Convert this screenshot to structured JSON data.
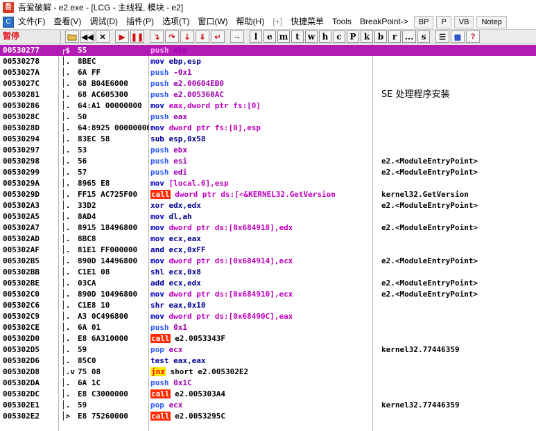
{
  "window": {
    "title": "吾爱破解 - e2.exe - [LCG - 主线程, 模块 - e2]"
  },
  "menu": {
    "items": [
      {
        "label": "文件(F)"
      },
      {
        "label": "查看(V)"
      },
      {
        "label": "调试(D)"
      },
      {
        "label": "插件(P)"
      },
      {
        "label": "选项(T)"
      },
      {
        "label": "窗口(W)"
      },
      {
        "label": "帮助(H)"
      },
      {
        "label": "[+]",
        "dim": true
      },
      {
        "label": "快捷菜单"
      },
      {
        "label": "Tools"
      },
      {
        "label": "BreakPoint->"
      }
    ],
    "tabs": [
      {
        "label": "BP"
      },
      {
        "label": "P"
      },
      {
        "label": "VB"
      },
      {
        "label": "Notep"
      }
    ]
  },
  "toolbar": {
    "status": "暂停",
    "letters": [
      "l",
      "e",
      "m",
      "t",
      "w",
      "h",
      "c",
      "P",
      "k",
      "b",
      "r",
      "...",
      "s"
    ]
  },
  "disasm": {
    "rows": [
      {
        "addr": "00530277",
        "mark": "┌$",
        "hex": "55",
        "mn": "push",
        "ops": "ebp",
        "cmt": "",
        "sel": true
      },
      {
        "addr": "00530278",
        "mark": "│.",
        "hex": "8BEC",
        "mn": "mov",
        "ops": "ebp,esp",
        "cmt": ""
      },
      {
        "addr": "0053027A",
        "mark": "│.",
        "hex": "6A FF",
        "mn": "push",
        "ops": "-0x1",
        "cmt": ""
      },
      {
        "addr": "0053027C",
        "mark": "│.",
        "hex": "68 B04E6000",
        "mn": "push",
        "ops": "e2.00604EB0",
        "cmt": ""
      },
      {
        "addr": "00530281",
        "mark": "│.",
        "hex": "68 AC605300",
        "mn": "push",
        "ops": "e2.005360AC",
        "cmt": "SE 处理程序安装",
        "cjk": true
      },
      {
        "addr": "00530286",
        "mark": "│.",
        "hex": "64:A1 00000000",
        "mn": "mov",
        "ops": "eax,dword ptr fs:[0]",
        "cmt": ""
      },
      {
        "addr": "0053028C",
        "mark": "│.",
        "hex": "50",
        "mn": "push",
        "ops": "eax",
        "cmt": ""
      },
      {
        "addr": "0053028D",
        "mark": "│.",
        "hex": "64:8925 00000000",
        "mn": "mov",
        "ops": "dword ptr fs:[0],esp",
        "cmt": ""
      },
      {
        "addr": "00530294",
        "mark": "│.",
        "hex": "83EC 58",
        "mn": "sub",
        "ops": "esp,0x58",
        "cmt": ""
      },
      {
        "addr": "00530297",
        "mark": "│.",
        "hex": "53",
        "mn": "push",
        "ops": "ebx",
        "cmt": ""
      },
      {
        "addr": "00530298",
        "mark": "│.",
        "hex": "56",
        "mn": "push",
        "ops": "esi",
        "cmt": "e2.<ModuleEntryPoint>"
      },
      {
        "addr": "00530299",
        "mark": "│.",
        "hex": "57",
        "mn": "push",
        "ops": "edi",
        "cmt": "e2.<ModuleEntryPoint>"
      },
      {
        "addr": "0053029A",
        "mark": "│.",
        "hex": "8965 E8",
        "mn": "mov",
        "ops": "[local.6],esp",
        "cmt": ""
      },
      {
        "addr": "0053029D",
        "mark": "│.",
        "hex": "FF15 AC725F00",
        "mn": "call",
        "ops": "dword ptr ds:[<&KERNEL32.GetVersion",
        "cmt": "kernel32.GetVersion"
      },
      {
        "addr": "005302A3",
        "mark": "│.",
        "hex": "33D2",
        "mn": "xor",
        "ops": "edx,edx",
        "cmt": "e2.<ModuleEntryPoint>"
      },
      {
        "addr": "005302A5",
        "mark": "│.",
        "hex": "8AD4",
        "mn": "mov",
        "ops": "dl,ah",
        "cmt": ""
      },
      {
        "addr": "005302A7",
        "mark": "│.",
        "hex": "8915 18496800",
        "mn": "mov",
        "ops": "dword ptr ds:[0x684918],edx",
        "cmt": "e2.<ModuleEntryPoint>"
      },
      {
        "addr": "005302AD",
        "mark": "│.",
        "hex": "8BC8",
        "mn": "mov",
        "ops": "ecx,eax",
        "cmt": ""
      },
      {
        "addr": "005302AF",
        "mark": "│.",
        "hex": "81E1 FF000000",
        "mn": "and",
        "ops": "ecx,0xFF",
        "cmt": ""
      },
      {
        "addr": "005302B5",
        "mark": "│.",
        "hex": "890D 14496800",
        "mn": "mov",
        "ops": "dword ptr ds:[0x684914],ecx",
        "cmt": "e2.<ModuleEntryPoint>"
      },
      {
        "addr": "005302BB",
        "mark": "│.",
        "hex": "C1E1 08",
        "mn": "shl",
        "ops": "ecx,0x8",
        "cmt": ""
      },
      {
        "addr": "005302BE",
        "mark": "│.",
        "hex": "03CA",
        "mn": "add",
        "ops": "ecx,edx",
        "cmt": "e2.<ModuleEntryPoint>"
      },
      {
        "addr": "005302C0",
        "mark": "│.",
        "hex": "890D 10496800",
        "mn": "mov",
        "ops": "dword ptr ds:[0x684910],ecx",
        "cmt": "e2.<ModuleEntryPoint>"
      },
      {
        "addr": "005302C6",
        "mark": "│.",
        "hex": "C1E8 10",
        "mn": "shr",
        "ops": "eax,0x10",
        "cmt": ""
      },
      {
        "addr": "005302C9",
        "mark": "│.",
        "hex": "A3 0C496800",
        "mn": "mov",
        "ops": "dword ptr ds:[0x68490C],eax",
        "cmt": ""
      },
      {
        "addr": "005302CE",
        "mark": "│.",
        "hex": "6A 01",
        "mn": "push",
        "ops": "0x1",
        "cmt": ""
      },
      {
        "addr": "005302D0",
        "mark": "│.",
        "hex": "E8 6A310000",
        "mn": "call",
        "ops": "e2.0053343F",
        "cmt": ""
      },
      {
        "addr": "005302D5",
        "mark": "│.",
        "hex": "59",
        "mn": "pop",
        "ops": "ecx",
        "cmt": "kernel32.77446359"
      },
      {
        "addr": "005302D6",
        "mark": "│.",
        "hex": "85C0",
        "mn": "test",
        "ops": "eax,eax",
        "cmt": ""
      },
      {
        "addr": "005302D8",
        "mark": "│.v",
        "hex": "75 08",
        "mn": "jnz",
        "ops": "short e2.005302E2",
        "cmt": ""
      },
      {
        "addr": "005302DA",
        "mark": "│.",
        "hex": "6A 1C",
        "mn": "push",
        "ops": "0x1C",
        "cmt": ""
      },
      {
        "addr": "005302DC",
        "mark": "│.",
        "hex": "E8 C3000000",
        "mn": "call",
        "ops": "e2.005303A4",
        "cmt": ""
      },
      {
        "addr": "005302E1",
        "mark": "│.",
        "hex": "59",
        "mn": "pop",
        "ops": "ecx",
        "cmt": "kernel32.77446359"
      },
      {
        "addr": "005302E2",
        "mark": "│>",
        "hex": "E8 75260000",
        "mn": "call",
        "ops": "e2.0053295C",
        "cmt": ""
      }
    ]
  }
}
